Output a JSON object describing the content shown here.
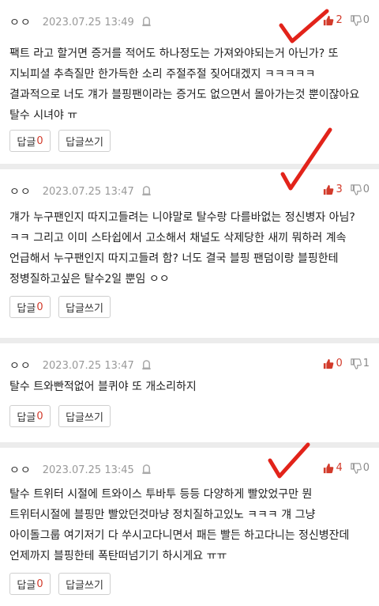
{
  "comments": [
    {
      "nick": "ㅇㅇ",
      "date": "2023.07.25 13:49",
      "up": "2",
      "down": "0",
      "body": "팩트 라고 할거면 증거를 적어도 하나정도는 가져와야되는거 아닌가? 또 지뇌피셜 추측질만 한가득한 소리 주절주절 짖어대겠지 ㅋㅋㅋㅋㅋ 결과적으로 너도 걔가 블핑팬이라는 증거도 없으면서 몰아가는것 뿐이잖아요 탈수 시녀야 ㅠ",
      "reply_label": "답글",
      "reply_count": "0",
      "write_label": "답글쓰기"
    },
    {
      "nick": "ㅇㅇ",
      "date": "2023.07.25 13:47",
      "up": "3",
      "down": "0",
      "body": "걔가 누구팬인지 따지고들려는 니야말로 탈수랑 다를바없는 정신병자 아님? ㅋㅋ 그리고 이미 스타쉽에서 고소해서 채널도 삭제당한 새끼 뭐하러 계속 언급해서 누구팬인지 따지고들려 함? 너도 결국 블핑 팬덤이랑 블핑한테 정병질하고싶은 탈수2일 뿐임 ㅇㅇ",
      "reply_label": "답글",
      "reply_count": "0",
      "write_label": "답글쓰기"
    },
    {
      "nick": "ㅇㅇ",
      "date": "2023.07.25 13:47",
      "up": "0",
      "down": "1",
      "body": "탈수 트와빤적없어 블퀴야 또 개소리하지",
      "reply_label": "답글",
      "reply_count": "0",
      "write_label": "답글쓰기"
    },
    {
      "nick": "ㅇㅇ",
      "date": "2023.07.25 13:45",
      "up": "4",
      "down": "0",
      "body": "탈수 트위터 시절에 트와이스 투바투 등등 다양하게 빨았었구만 뭔 트위터시절에 블핑만 빨았던것마냥 정치질하고있노 ㅋㅋㅋ 걔 그냥 아이돌그룹 여기저기 다 쑤시고다니면서 패든 빨든 하고다니는 정신병잔데 언제까지 블핑한테 폭탄떠넘기기 하시게요 ㅠㅠ",
      "reply_label": "답글",
      "reply_count": "0",
      "write_label": "답글쓰기"
    }
  ],
  "colors": {
    "accent_red": "#e2231a",
    "up_count": "#d23a2a",
    "down_count": "#888888"
  },
  "icons": {
    "report": "report-icon",
    "thumb_up": "thumb-up-icon",
    "thumb_down": "thumb-down-icon",
    "annotation": "checkmark-annotation"
  }
}
